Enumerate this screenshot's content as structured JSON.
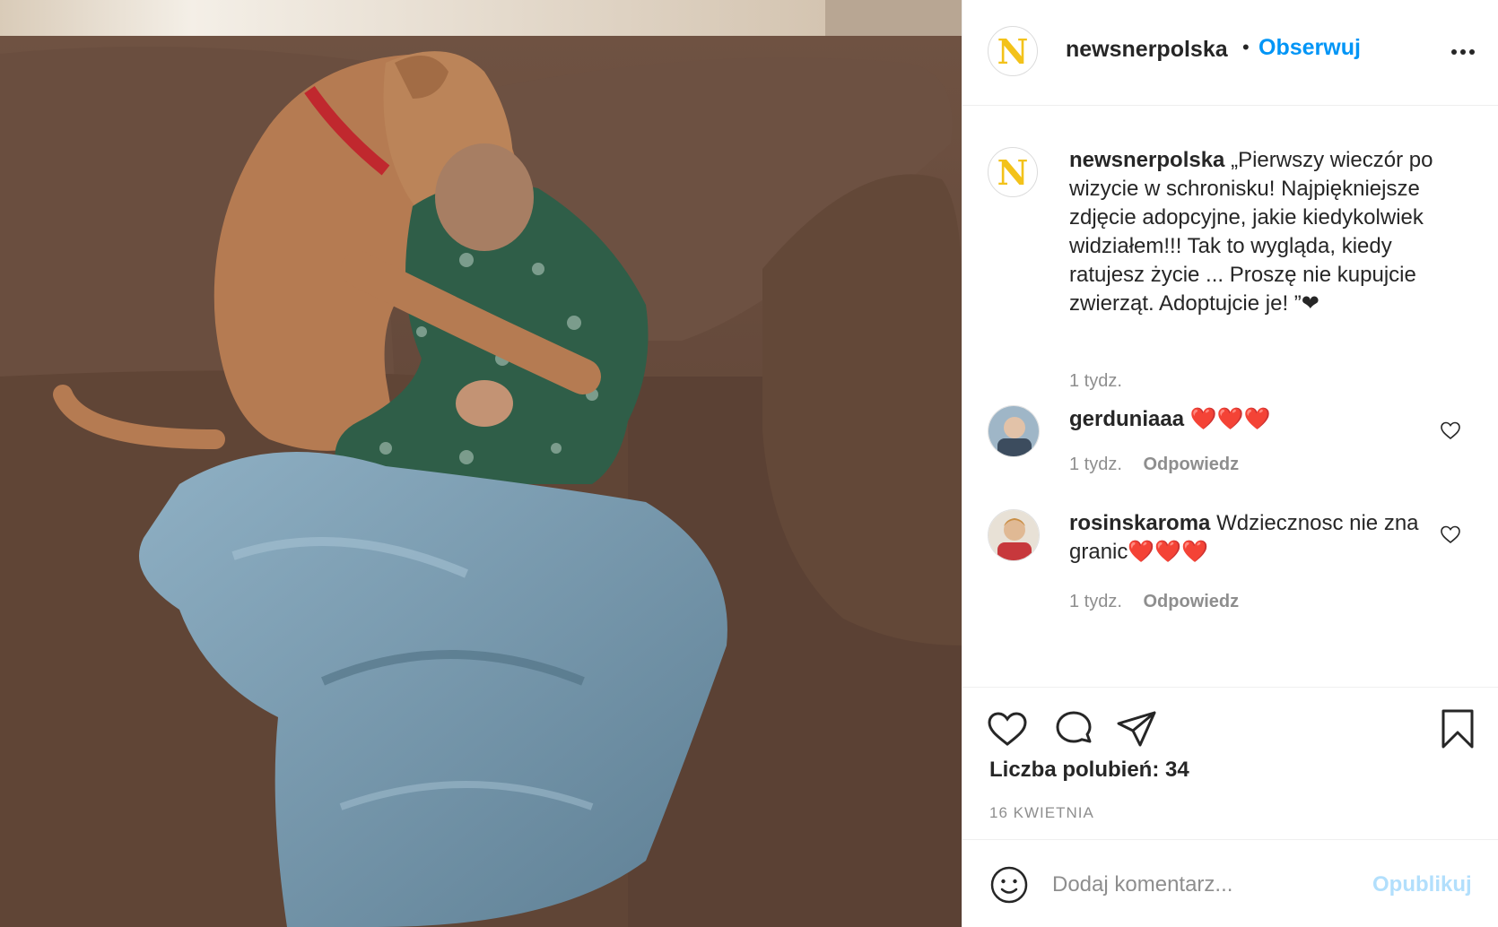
{
  "header": {
    "logo_letter": "N",
    "username": "newsnerpolska",
    "separator": "•",
    "follow_label": "Obserwuj"
  },
  "caption": {
    "logo_letter": "N",
    "username": "newsnerpolska",
    "text": "„Pierwszy wieczór po wizycie w schronisku! Najpiękniejsze zdjęcie adopcyjne, jakie kiedykolwiek widziałem!!! Tak to wygląda, kiedy ratujesz życie ... Proszę nie kupujcie zwierząt. Adoptujcie je! ”❤",
    "time": "1 tydz."
  },
  "comments": [
    {
      "username": "gerduniaaa",
      "text": "❤️❤️❤️",
      "time": "1 tydz.",
      "reply_label": "Odpowiedz"
    },
    {
      "username": "rosinskaroma",
      "text": "Wdziecznosc nie zna granic❤️❤️❤️",
      "time": "1 tydz.",
      "reply_label": "Odpowiedz"
    }
  ],
  "actions": {
    "like_icon": "heart-icon",
    "comment_icon": "comment-bubble-icon",
    "share_icon": "paper-plane-icon",
    "save_icon": "bookmark-icon",
    "likes_text": "Liczba polubień: 34",
    "date": "16 KWIETNIA"
  },
  "add_comment": {
    "placeholder": "Dodaj komentarz...",
    "publish_label": "Opublikuj"
  },
  "colors": {
    "link_blue": "#0095f6",
    "publish_disabled": "#b2dffc",
    "logo_yellow": "#f3c21a",
    "muted": "#8e8e8e"
  }
}
